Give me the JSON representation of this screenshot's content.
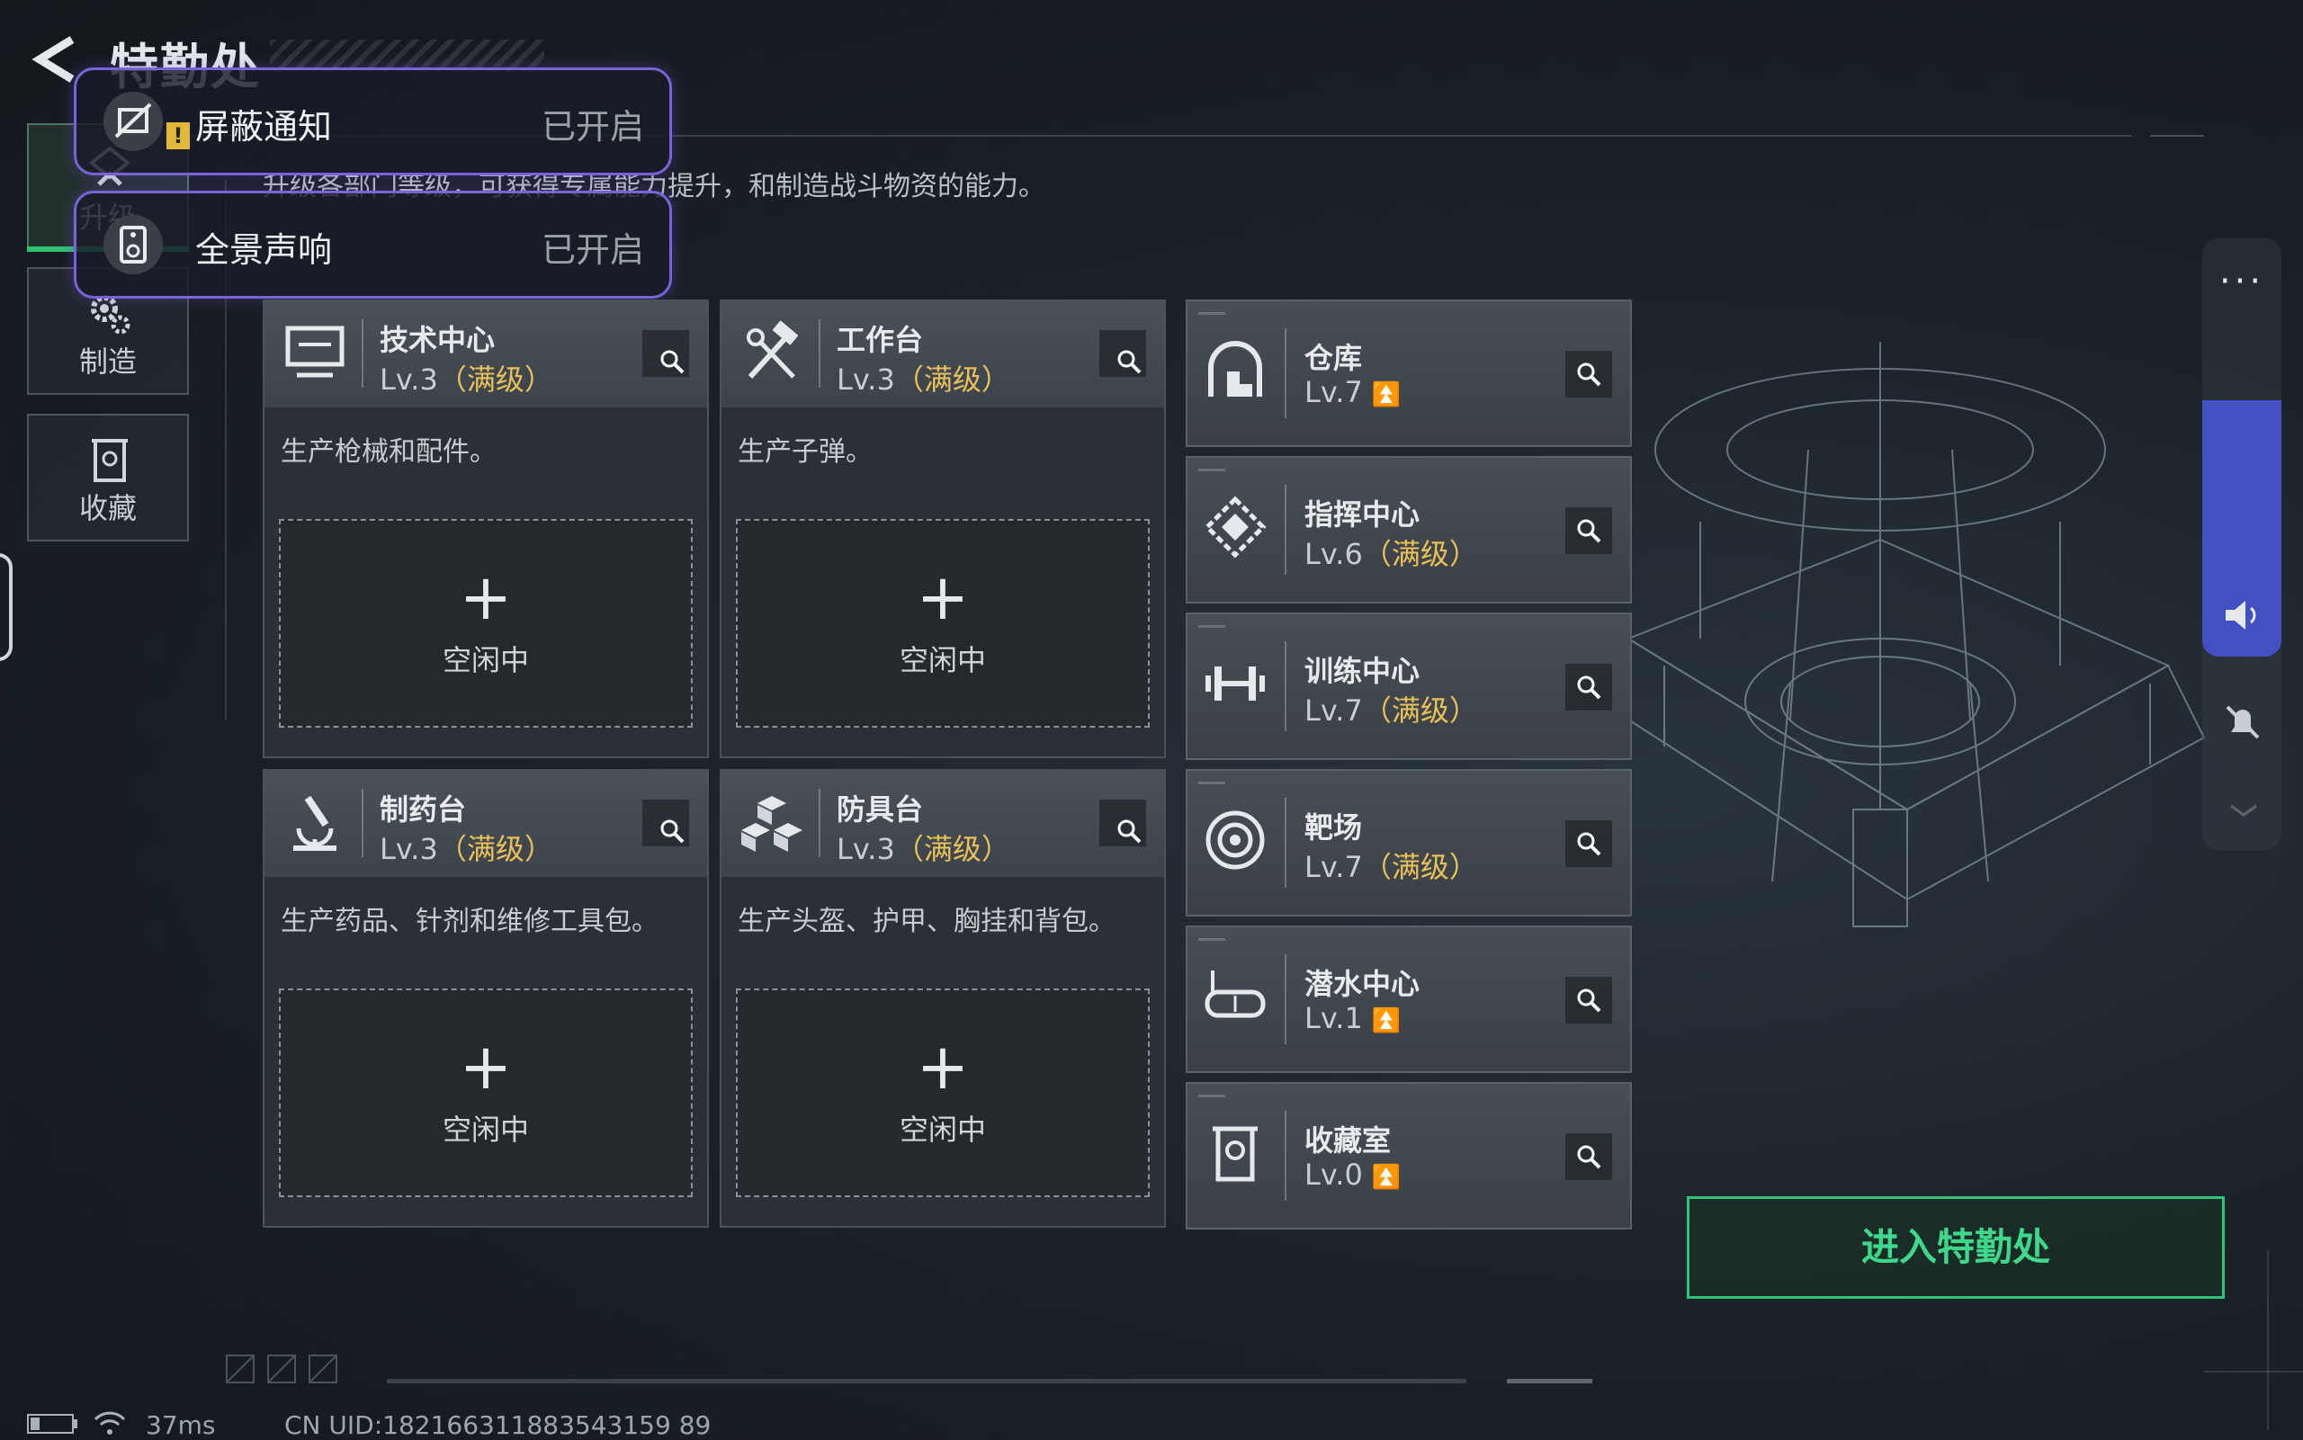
{
  "header": {
    "title": "特勤处",
    "subtitle": "升级各部门等级，可获得专属能力提升，和制造战斗物资的能力。"
  },
  "notifications": [
    {
      "name": "屏蔽通知",
      "state": "已开启",
      "warn": "!"
    },
    {
      "name": "全景声响",
      "state": "已开启"
    }
  ],
  "nav": {
    "upgrade": "升级",
    "craft": "制造",
    "collect": "收藏"
  },
  "cards": [
    {
      "name": "技术中心",
      "level": "Lv.3",
      "max": "（满级）",
      "desc": "生产枪械和配件。",
      "plus": "+",
      "status": "空闲中"
    },
    {
      "name": "工作台",
      "level": "Lv.3",
      "max": "（满级）",
      "desc": "生产子弹。",
      "plus": "+",
      "status": "空闲中"
    },
    {
      "name": "制药台",
      "level": "Lv.3",
      "max": "（满级）",
      "desc": "生产药品、针剂和维修工具包。",
      "plus": "+",
      "status": "空闲中"
    },
    {
      "name": "防具台",
      "level": "Lv.3",
      "max": "（满级）",
      "desc": "生产头盔、护甲、胸挂和背包。",
      "plus": "+",
      "status": "空闲中"
    }
  ],
  "facilities": [
    {
      "name": "仓库",
      "level": "Lv.7",
      "max": "",
      "icon": "warehouse-icon"
    },
    {
      "name": "指挥中心",
      "level": "Lv.6",
      "max": "（满级）",
      "icon": "command-icon"
    },
    {
      "name": "训练中心",
      "level": "Lv.7",
      "max": "（满级）",
      "icon": "dumbbell-icon"
    },
    {
      "name": "靶场",
      "level": "Lv.7",
      "max": "（满级）",
      "icon": "target-icon"
    },
    {
      "name": "潜水中心",
      "level": "Lv.1",
      "max": "",
      "icon": "dive-mask-icon"
    },
    {
      "name": "收藏室",
      "level": "Lv.0",
      "max": "",
      "icon": "collection-icon"
    }
  ],
  "enter_button": "进入特勤处",
  "status_bar": {
    "ping": "37ms",
    "uid": "CN UID:182166311883543159 89"
  },
  "colors": {
    "accent_green": "#2ec27a",
    "max_level_gold": "#e8c15a",
    "toast_border": "#7a63d9",
    "volume_blue": "#4250c2"
  }
}
